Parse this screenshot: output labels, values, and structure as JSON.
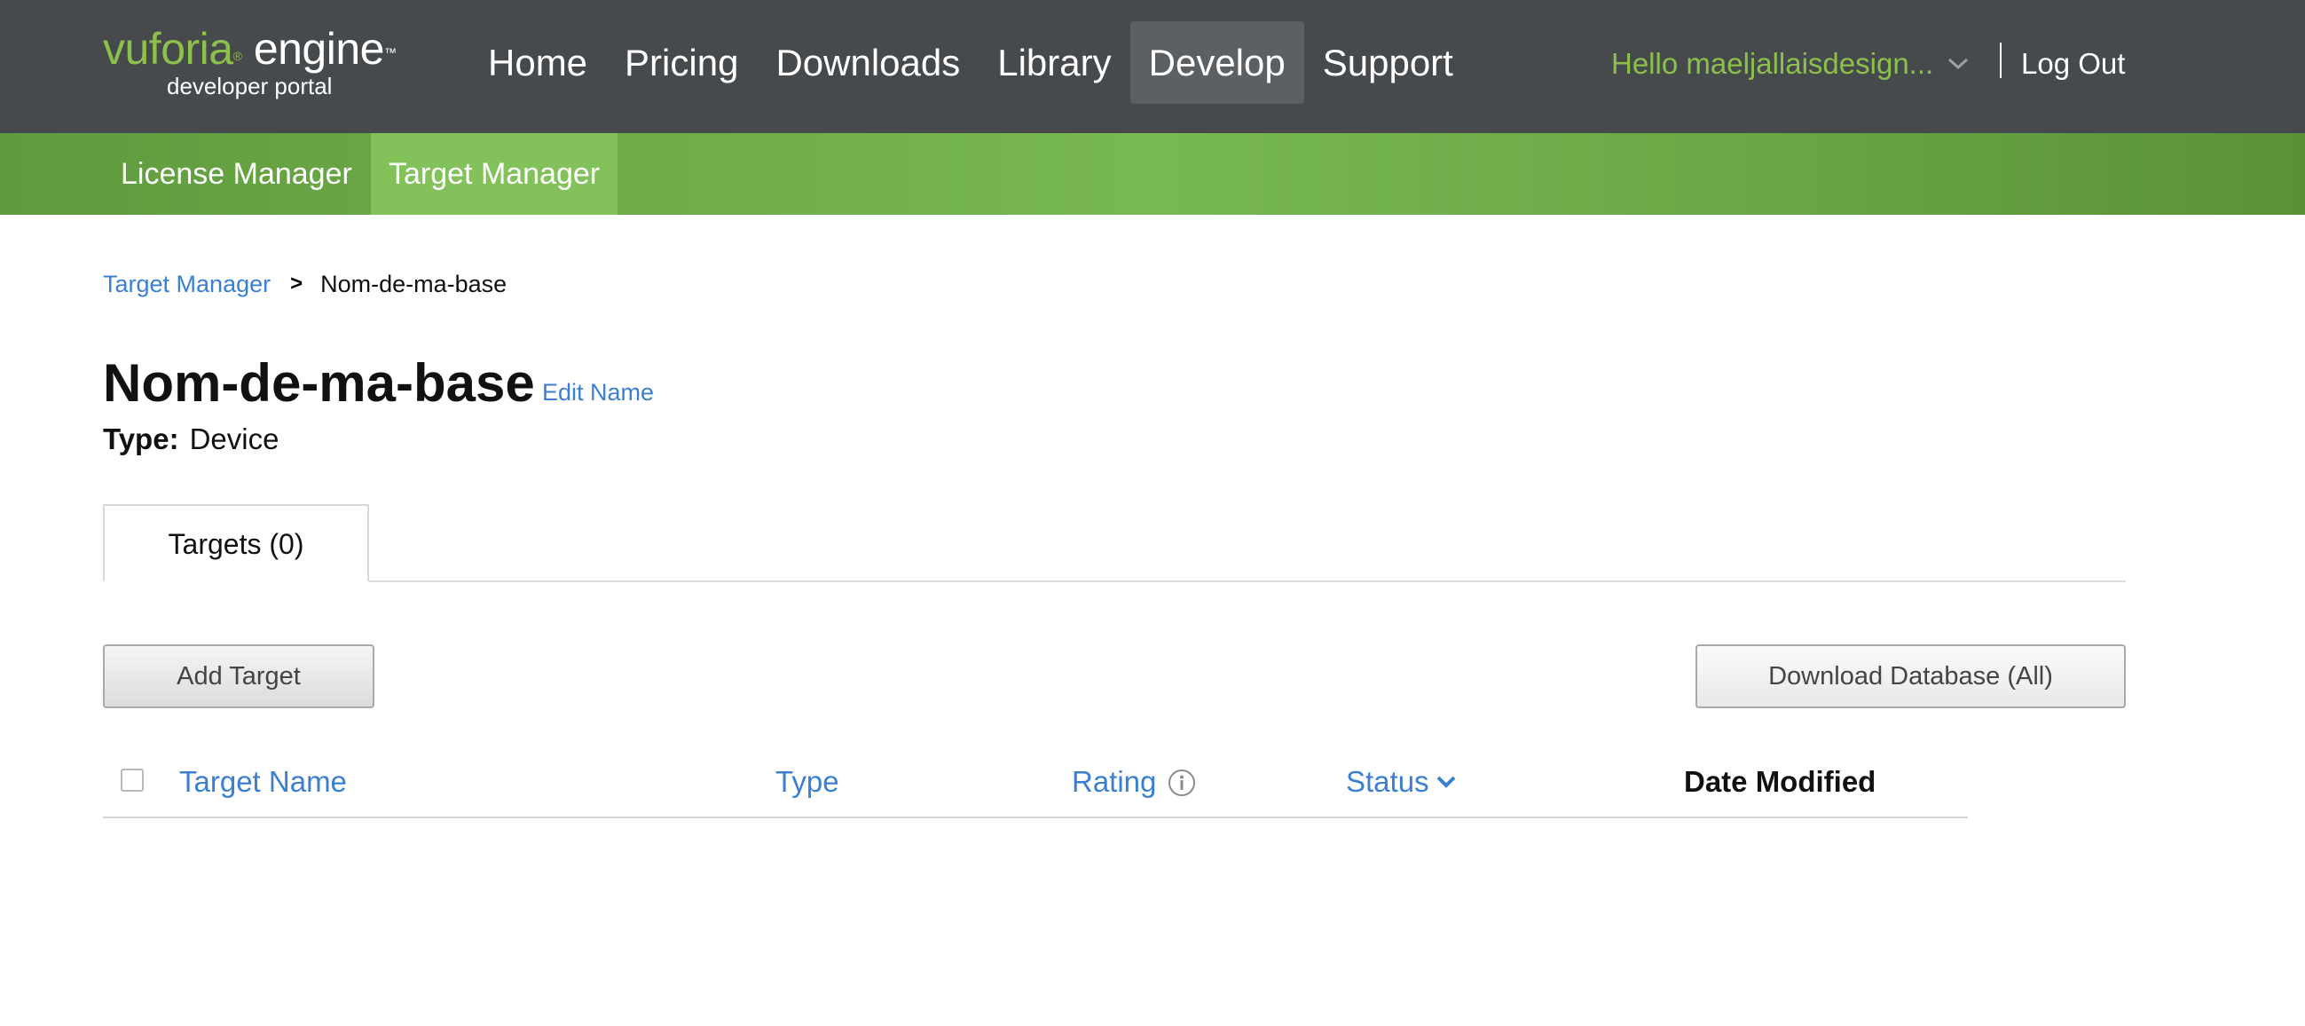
{
  "logo": {
    "brand_green": "vuforia",
    "registered": "®",
    "brand_white": "engine",
    "trademark": "™",
    "subtitle": "developer portal"
  },
  "nav": {
    "items": [
      {
        "label": "Home",
        "active": false
      },
      {
        "label": "Pricing",
        "active": false
      },
      {
        "label": "Downloads",
        "active": false
      },
      {
        "label": "Library",
        "active": false
      },
      {
        "label": "Develop",
        "active": true
      },
      {
        "label": "Support",
        "active": false
      }
    ],
    "user_greeting": "Hello maeljallaisdesign...",
    "logout_label": "Log Out"
  },
  "subnav": {
    "items": [
      {
        "label": "License Manager",
        "active": false
      },
      {
        "label": "Target Manager",
        "active": true
      }
    ]
  },
  "breadcrumb": {
    "parent": "Target Manager",
    "separator": ">",
    "current": "Nom-de-ma-base"
  },
  "database": {
    "name": "Nom-de-ma-base",
    "edit_label": "Edit Name",
    "type_label": "Type:",
    "type_value": "Device"
  },
  "tabs": [
    {
      "label": "Targets (0)",
      "active": true
    }
  ],
  "actions": {
    "add_target": "Add Target",
    "download_database": "Download Database (All)"
  },
  "table": {
    "columns": {
      "target_name": "Target Name",
      "type": "Type",
      "rating": "Rating",
      "status": "Status",
      "date_modified": "Date Modified"
    },
    "rows": []
  },
  "colors": {
    "topnav_bg": "#474a4d",
    "brand_green": "#8cc04b",
    "subnav_green": "#6eab47",
    "link_blue": "#3b7fd3"
  }
}
